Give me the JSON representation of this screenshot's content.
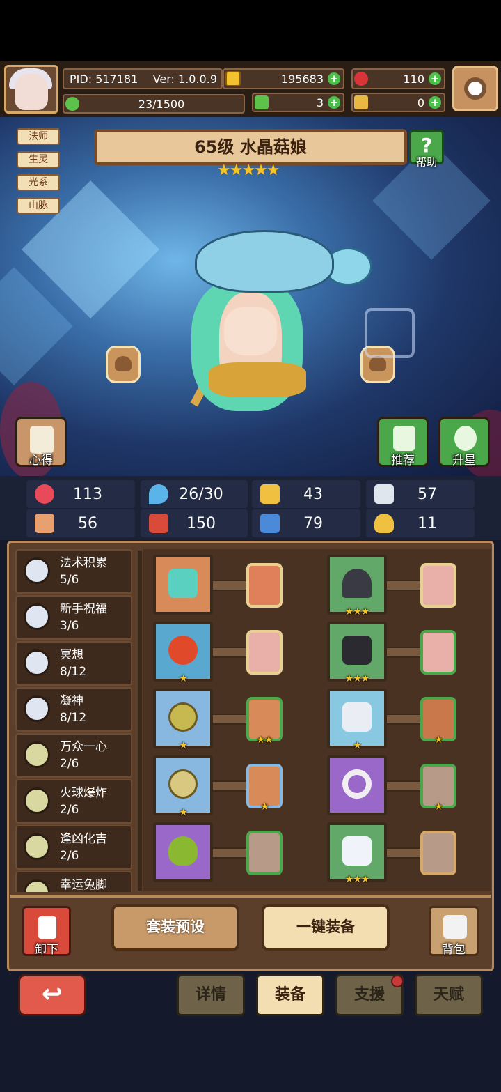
{
  "hud": {
    "pid": "PID: 517181",
    "ver": "Ver: 1.0.0.9",
    "exp": "23/1500",
    "gold": "195683",
    "gems": "110",
    "clover": "3",
    "keys": "0"
  },
  "hero": {
    "tags": [
      "法师",
      "生灵",
      "光系",
      "山脉"
    ],
    "title": "65级 水晶菇娘",
    "stars": "★★★★★",
    "help": "帮助",
    "insight": "心得",
    "recommend": "推荐",
    "star_up": "升星"
  },
  "stats": [
    "113",
    "26/30",
    "43",
    "57",
    "56",
    "150",
    "79",
    "11"
  ],
  "skills": [
    {
      "name": "法术积累",
      "level": "5/6"
    },
    {
      "name": "新手祝福",
      "level": "3/6"
    },
    {
      "name": "冥想",
      "level": "8/12"
    },
    {
      "name": "凝神",
      "level": "8/12"
    },
    {
      "name": "万众一心",
      "level": "2/6"
    },
    {
      "name": "火球爆炸",
      "level": "2/6"
    },
    {
      "name": "逢凶化吉",
      "level": "2/6"
    },
    {
      "name": "幸运兔脚",
      "level": ""
    }
  ],
  "equipment": [
    {
      "slot": "wand",
      "stars": "",
      "card_stars": ""
    },
    {
      "slot": "witch-hat",
      "stars": "★★★",
      "card_stars": ""
    },
    {
      "slot": "fire-orb",
      "stars": "★",
      "card_stars": ""
    },
    {
      "slot": "dark-armor",
      "stars": "★★★",
      "card_stars": ""
    },
    {
      "slot": "heart-necklace",
      "stars": "★",
      "card_stars": "★★"
    },
    {
      "slot": "ice-boots",
      "stars": "★",
      "card_stars": "★"
    },
    {
      "slot": "gold-coin-charm",
      "stars": "★",
      "card_stars": "★"
    },
    {
      "slot": "ring",
      "stars": "",
      "card_stars": "★"
    },
    {
      "slot": "green-gem",
      "stars": "",
      "card_stars": ""
    },
    {
      "slot": "white-shoes",
      "stars": "★★★",
      "card_stars": ""
    }
  ],
  "actions": {
    "unload": "卸下",
    "preset": "套装预设",
    "auto_equip": "一键装备",
    "bag": "背包"
  },
  "tabs": {
    "details": "详情",
    "equip": "装备",
    "support": "支援",
    "talent": "天赋"
  }
}
